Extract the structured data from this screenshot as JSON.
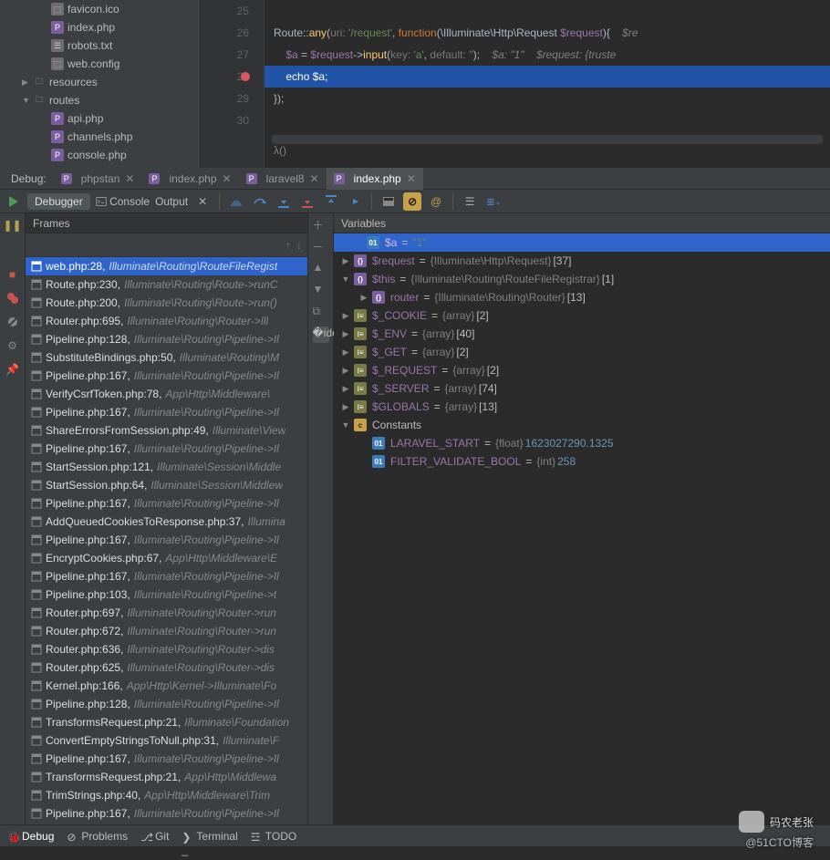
{
  "tree": {
    "files_top": [
      "favicon.ico",
      "index.php",
      "robots.txt",
      "web.config"
    ],
    "folders": [
      {
        "name": "resources",
        "open": false
      },
      {
        "name": "routes",
        "open": true
      }
    ],
    "routes_files": [
      "api.php",
      "channels.php",
      "console.php"
    ]
  },
  "editor": {
    "lines": [
      25,
      26,
      27,
      28,
      29,
      30
    ],
    "breakpoint_line": 28,
    "code": {
      "l26_a": "Route",
      "l26_b": "::",
      "l26_c": "any",
      "l26_d": "(",
      "l26_uri": "uri:",
      "l26_e": " '/request'",
      "l26_f": ", ",
      "l26_g": "function",
      "l26_h": "(\\Illuminate\\Http\\",
      "l26_i": "Request ",
      "l26_j": "$request",
      "l26_k": "){    ",
      "l26_cmt": "$re",
      "l27_a": "    ",
      "l27_b": "$a",
      "l27_c": " = ",
      "l27_d": "$request",
      "l27_e": "->",
      "l27_f": "input",
      "l27_g": "(",
      "l27_key": "key:",
      "l27_h": " 'a'",
      "l27_i": ", ",
      "l27_def": "default:",
      "l27_j": " ''",
      "l27_k": ");    ",
      "l27_cmt": "$a: \"1\"    $request: {truste",
      "l28_a": "    ",
      "l28_b": "echo ",
      "l28_c": "$a",
      "l28_d": ";",
      "l29_a": "});"
    },
    "lambda": "λ()"
  },
  "debug_tabs": {
    "label": "Debug:",
    "items": [
      {
        "name": "phpstan",
        "active": false,
        "closable": true
      },
      {
        "name": "index.php",
        "active": false,
        "closable": true
      },
      {
        "name": "laravel8",
        "active": false,
        "closable": true
      },
      {
        "name": "index.php",
        "active": true,
        "closable": true
      }
    ]
  },
  "toolbar": {
    "debugger": "Debugger",
    "console": "Console",
    "output": "Output"
  },
  "frames": {
    "title": "Frames",
    "items": [
      {
        "loc": "web.php:28,",
        "path": "Illuminate\\Routing\\RouteFileRegist",
        "sel": true
      },
      {
        "loc": "Route.php:230,",
        "path": "Illuminate\\Routing\\Route->runC"
      },
      {
        "loc": "Route.php:200,",
        "path": "Illuminate\\Routing\\Route->run()"
      },
      {
        "loc": "Router.php:695,",
        "path": "Illuminate\\Routing\\Router->Ill"
      },
      {
        "loc": "Pipeline.php:128,",
        "path": "Illuminate\\Routing\\Pipeline->Il"
      },
      {
        "loc": "SubstituteBindings.php:50,",
        "path": "Illuminate\\Routing\\M"
      },
      {
        "loc": "Pipeline.php:167,",
        "path": "Illuminate\\Routing\\Pipeline->Il"
      },
      {
        "loc": "VerifyCsrfToken.php:78,",
        "path": "App\\Http\\Middleware\\"
      },
      {
        "loc": "Pipeline.php:167,",
        "path": "Illuminate\\Routing\\Pipeline->Il"
      },
      {
        "loc": "ShareErrorsFromSession.php:49,",
        "path": "Illuminate\\View"
      },
      {
        "loc": "Pipeline.php:167,",
        "path": "Illuminate\\Routing\\Pipeline->Il"
      },
      {
        "loc": "StartSession.php:121,",
        "path": "Illuminate\\Session\\Middle"
      },
      {
        "loc": "StartSession.php:64,",
        "path": "Illuminate\\Session\\Middlew"
      },
      {
        "loc": "Pipeline.php:167,",
        "path": "Illuminate\\Routing\\Pipeline->Il"
      },
      {
        "loc": "AddQueuedCookiesToResponse.php:37,",
        "path": "Illumina"
      },
      {
        "loc": "Pipeline.php:167,",
        "path": "Illuminate\\Routing\\Pipeline->Il"
      },
      {
        "loc": "EncryptCookies.php:67,",
        "path": "App\\Http\\Middleware\\E"
      },
      {
        "loc": "Pipeline.php:167,",
        "path": "Illuminate\\Routing\\Pipeline->Il"
      },
      {
        "loc": "Pipeline.php:103,",
        "path": "Illuminate\\Routing\\Pipeline->t"
      },
      {
        "loc": "Router.php:697,",
        "path": "Illuminate\\Routing\\Router->run"
      },
      {
        "loc": "Router.php:672,",
        "path": "Illuminate\\Routing\\Router->run"
      },
      {
        "loc": "Router.php:636,",
        "path": "Illuminate\\Routing\\Router->dis"
      },
      {
        "loc": "Router.php:625,",
        "path": "Illuminate\\Routing\\Router->dis"
      },
      {
        "loc": "Kernel.php:166,",
        "path": "App\\Http\\Kernel->Illuminate\\Fo"
      },
      {
        "loc": "Pipeline.php:128,",
        "path": "Illuminate\\Routing\\Pipeline->Il"
      },
      {
        "loc": "TransformsRequest.php:21,",
        "path": "Illuminate\\Foundation"
      },
      {
        "loc": "ConvertEmptyStringsToNull.php:31,",
        "path": "Illuminate\\F"
      },
      {
        "loc": "Pipeline.php:167,",
        "path": "Illuminate\\Routing\\Pipeline->Il"
      },
      {
        "loc": "TransformsRequest.php:21,",
        "path": "App\\Http\\Middlewa"
      },
      {
        "loc": "TrimStrings.php:40,",
        "path": "App\\Http\\Middleware\\Trim"
      },
      {
        "loc": "Pipeline.php:167,",
        "path": "Illuminate\\Routing\\Pipeline->Il"
      }
    ]
  },
  "variables": {
    "title": "Variables",
    "items": [
      {
        "kind": "box",
        "tgl": "",
        "name": "$a",
        "eq": " = ",
        "val": "\"1\"",
        "cls": "vval",
        "sel": true,
        "pad": 14
      },
      {
        "kind": "brace",
        "tgl": ">",
        "name": "$request",
        "eq": " = ",
        "type": "{Illuminate\\Http\\Request}",
        "brk": " [37]",
        "pad": 0
      },
      {
        "kind": "brace",
        "tgl": "v",
        "name": "$this",
        "eq": " = ",
        "type": "{Illuminate\\Routing\\RouteFileRegistrar}",
        "brk": " [1]",
        "pad": 0
      },
      {
        "kind": "brace",
        "tgl": ">",
        "name": "router",
        "eq": " = ",
        "type": "{Illuminate\\Routing\\Router}",
        "brk": " [13]",
        "pad": 20
      },
      {
        "kind": "arr",
        "tgl": ">",
        "name": "$_COOKIE",
        "eq": " = ",
        "type": "{array}",
        "brk": " [2]",
        "pad": 0
      },
      {
        "kind": "arr",
        "tgl": ">",
        "name": "$_ENV",
        "eq": " = ",
        "type": "{array}",
        "brk": " [40]",
        "pad": 0
      },
      {
        "kind": "arr",
        "tgl": ">",
        "name": "$_GET",
        "eq": " = ",
        "type": "{array}",
        "brk": " [2]",
        "pad": 0
      },
      {
        "kind": "arr",
        "tgl": ">",
        "name": "$_REQUEST",
        "eq": " = ",
        "type": "{array}",
        "brk": " [2]",
        "pad": 0
      },
      {
        "kind": "arr",
        "tgl": ">",
        "name": "$_SERVER",
        "eq": " = ",
        "type": "{array}",
        "brk": " [74]",
        "pad": 0
      },
      {
        "kind": "arr",
        "tgl": ">",
        "name": "$GLOBALS",
        "eq": " = ",
        "type": "{array}",
        "brk": " [13]",
        "pad": 0
      },
      {
        "kind": "c",
        "tgl": "v",
        "name": "Constants",
        "pad": 0,
        "plain": true
      },
      {
        "kind": "box",
        "tgl": "",
        "name": "LARAVEL_START",
        "eq": " = ",
        "type": "{float} ",
        "num": "1623027290.1325",
        "pad": 20
      },
      {
        "kind": "box",
        "tgl": "",
        "name": "FILTER_VALIDATE_BOOL",
        "eq": " = ",
        "type": "{int} ",
        "num": "258",
        "pad": 20
      }
    ]
  },
  "statusbar": {
    "items": [
      {
        "label": "Debug",
        "active": true,
        "ico": "bug"
      },
      {
        "label": "Problems",
        "ico": "warn"
      },
      {
        "label": "Git",
        "ico": "git"
      },
      {
        "label": "Terminal",
        "ico": "term"
      },
      {
        "label": "TODO",
        "ico": "todo"
      }
    ]
  },
  "watermark": {
    "main": "码农老张",
    "sub": "@51CTO博客"
  }
}
